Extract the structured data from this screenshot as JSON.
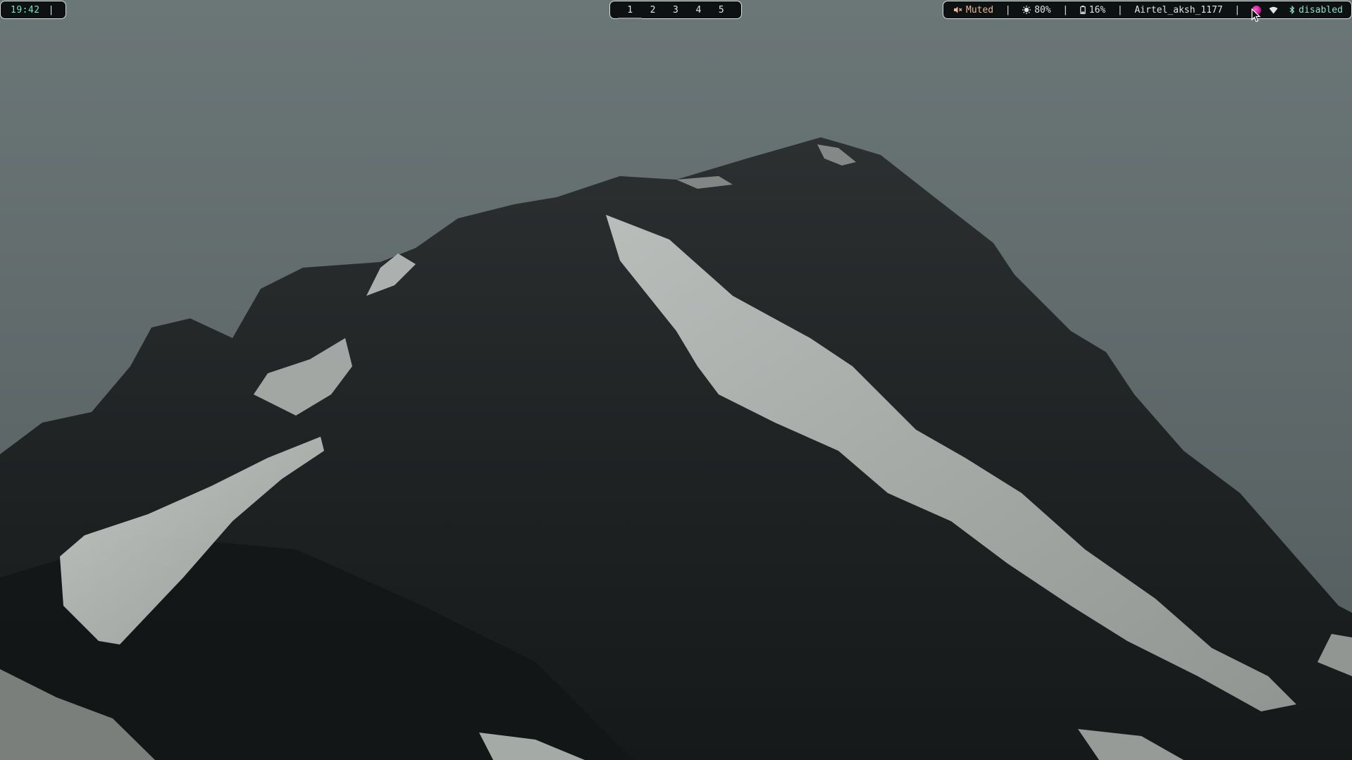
{
  "clock": {
    "time": "19:42",
    "separator": "|"
  },
  "workspaces": [
    {
      "label": "1",
      "active": true
    },
    {
      "label": "2",
      "active": false
    },
    {
      "label": "3",
      "active": false
    },
    {
      "label": "4",
      "active": false
    },
    {
      "label": "5",
      "active": false
    }
  ],
  "status": {
    "volume": {
      "icon": "speaker-muted-icon",
      "label": "Muted"
    },
    "brightness": {
      "icon": "brightness-icon",
      "value": "80%"
    },
    "battery": {
      "icon": "battery-icon",
      "value": "16%"
    },
    "network": {
      "ssid": "Airtel_aksh_1177"
    },
    "tray": {
      "app_icon": "tray-app-icon",
      "wifi_icon": "wifi-icon"
    },
    "bluetooth": {
      "icon": "bluetooth-icon",
      "label": "disabled"
    },
    "separator": "|"
  },
  "colors": {
    "bar_bg": "#0e1112",
    "bar_border": "#d7dcdc",
    "accent_green": "#7fe0c0",
    "muted_color": "#e8b79a",
    "sky": "#6a7576"
  },
  "wallpaper": {
    "subject": "dark snow-streaked mountain peak"
  }
}
